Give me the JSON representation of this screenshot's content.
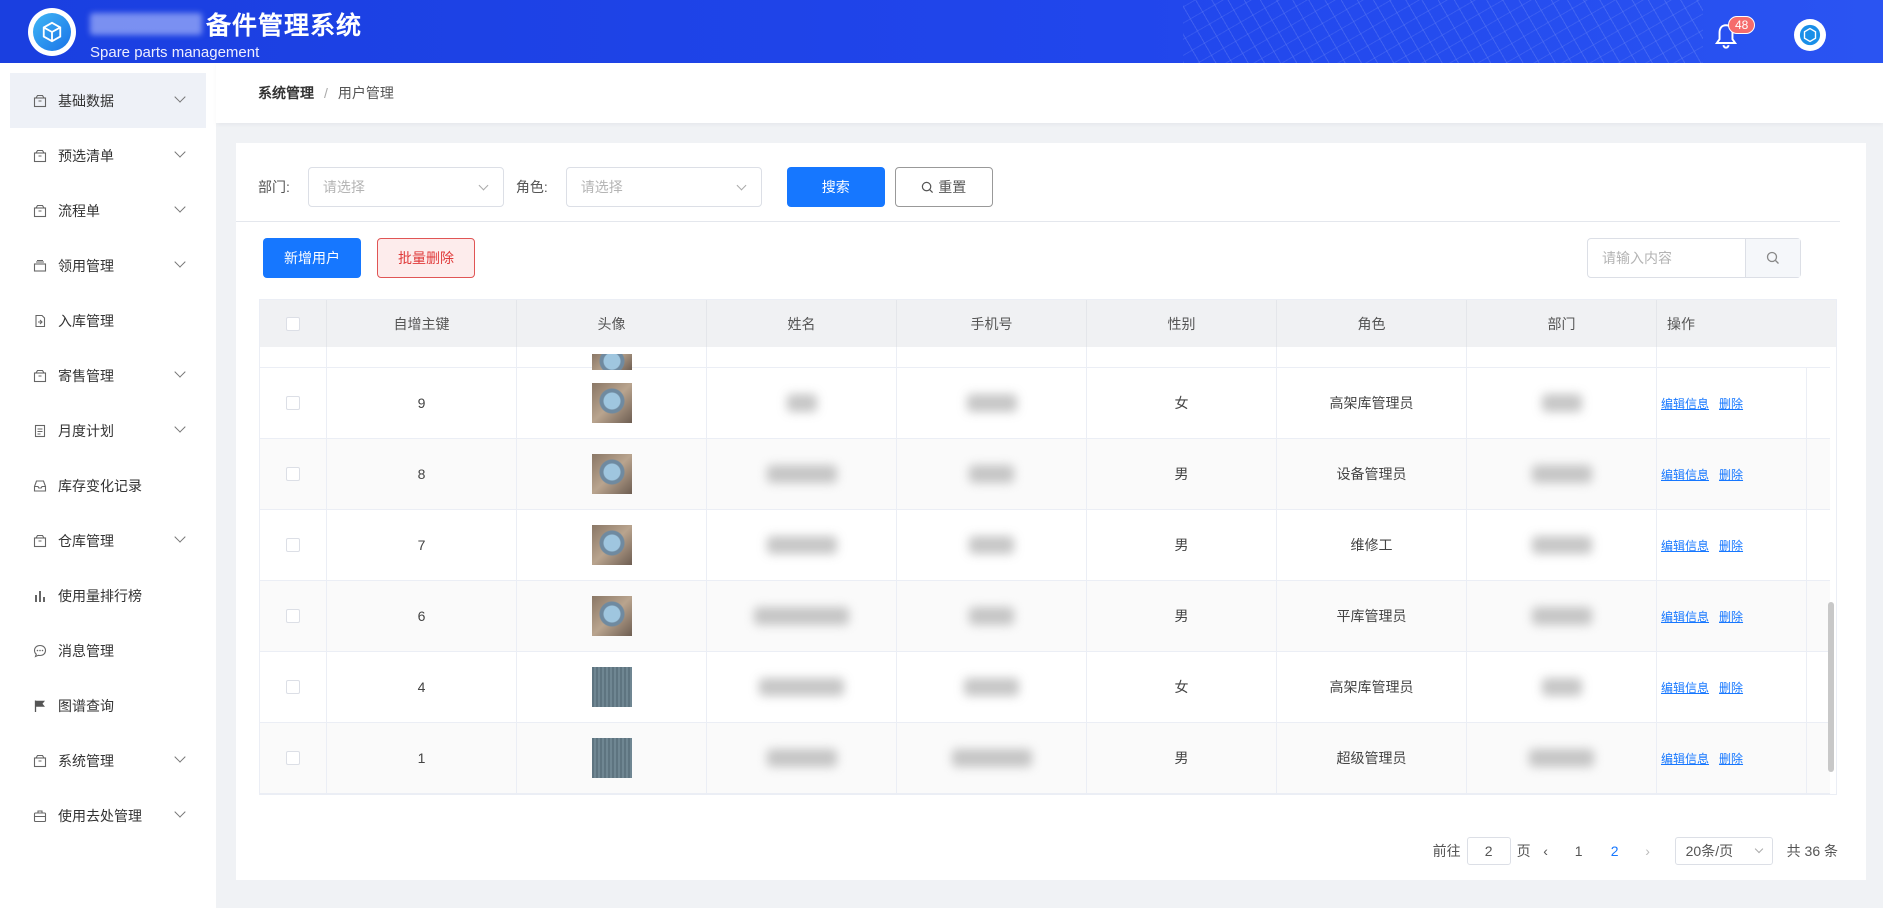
{
  "header": {
    "title": "备件管理系统",
    "subtitle": "Spare parts management",
    "notification_count": "48"
  },
  "sidebar": {
    "items": [
      {
        "label": "基础数据",
        "icon": "box-icon",
        "expandable": true
      },
      {
        "label": "预选清单",
        "icon": "box-icon",
        "expandable": true
      },
      {
        "label": "流程单",
        "icon": "box-icon",
        "expandable": true
      },
      {
        "label": "领用管理",
        "icon": "tray-icon",
        "expandable": true
      },
      {
        "label": "入库管理",
        "icon": "file-import-icon",
        "expandable": false
      },
      {
        "label": "寄售管理",
        "icon": "box-icon",
        "expandable": true
      },
      {
        "label": "月度计划",
        "icon": "document-icon",
        "expandable": true
      },
      {
        "label": "库存变化记录",
        "icon": "inbox-icon",
        "expandable": false
      },
      {
        "label": "仓库管理",
        "icon": "box-icon",
        "expandable": true
      },
      {
        "label": "使用量排行榜",
        "icon": "bar-chart-icon",
        "expandable": false
      },
      {
        "label": "消息管理",
        "icon": "chat-icon",
        "expandable": false
      },
      {
        "label": "图谱查询",
        "icon": "flag-icon",
        "expandable": false
      },
      {
        "label": "系统管理",
        "icon": "box-icon",
        "expandable": true
      },
      {
        "label": "使用去处管理",
        "icon": "briefcase-icon",
        "expandable": true
      }
    ]
  },
  "breadcrumb": {
    "parent": "系统管理",
    "separator": "/",
    "current": "用户管理"
  },
  "filters": {
    "dept_label": "部门:",
    "dept_placeholder": "请选择",
    "role_label": "角色:",
    "role_placeholder": "请选择",
    "search_label": "搜索",
    "reset_label": "重置"
  },
  "toolbar": {
    "add_label": "新增用户",
    "batch_delete_label": "批量删除",
    "search_placeholder": "请输入内容"
  },
  "table": {
    "headers": [
      "自增主键",
      "头像",
      "姓名",
      "手机号",
      "性别",
      "角色",
      "部门",
      "操作"
    ],
    "rows": [
      {
        "id": "9",
        "avatar": "photo",
        "gender": "女",
        "role": "高架库管理员"
      },
      {
        "id": "8",
        "avatar": "photo",
        "gender": "男",
        "role": "设备管理员"
      },
      {
        "id": "7",
        "avatar": "photo",
        "gender": "男",
        "role": "维修工"
      },
      {
        "id": "6",
        "avatar": "photo",
        "gender": "男",
        "role": "平库管理员"
      },
      {
        "id": "4",
        "avatar": "fabric",
        "gender": "女",
        "role": "高架库管理员"
      },
      {
        "id": "1",
        "avatar": "fabric",
        "gender": "男",
        "role": "超级管理员"
      }
    ],
    "edit_label": "编辑信息",
    "delete_label": "删除"
  },
  "pagination": {
    "goto_label": "前往",
    "goto_value": "2",
    "page_suffix": "页",
    "pages": [
      "1",
      "2"
    ],
    "current_page": "2",
    "page_size": "20条/页",
    "total": "共 36 条"
  },
  "colors": {
    "primary": "#1677ff",
    "header": "#2146ec",
    "danger": "#e03a3a"
  }
}
